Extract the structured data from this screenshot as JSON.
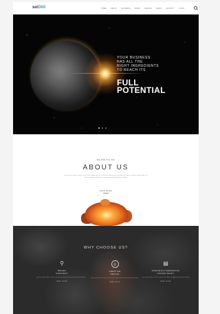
{
  "header": {
    "logo_main": "sol",
    "logo_accent": "360",
    "nav": [
      "HOME",
      "ABOUT",
      "BUSINESS",
      "WORK",
      "PEOPLE",
      "NEWS",
      "CONTACT",
      "LOGIN"
    ]
  },
  "hero": {
    "intro": "YOUR BUSINESS\nHAS ALL THE\nRIGHT INGREDIENTS\nTO REACH ITS",
    "headline": "FULL\nPOTENTIAL"
  },
  "about": {
    "kicker": "WE ARE SOL 360",
    "title": "ABOUT US",
    "body": "Lorem ipsum dolor sit amet, consectetur adipiscing elit, sed do eiusmod tempor incididunt ut labore et dolore magna aliqua. Ut enim ad minim veniam, quis nostrud exercitation ullamco laboris.",
    "link": "READ MORE"
  },
  "why": {
    "title": "WHY CHOOSE US?",
    "features": [
      {
        "icon": "person-icon",
        "glyph": "⚲",
        "name": "BRAND\nSTRATEGY",
        "desc": "Lorem ipsum dolor sit amet consectetur adipiscing elit sed do eiusmod tempor.",
        "more": "READ MORE"
      },
      {
        "icon": "target-icon",
        "glyph": "◎",
        "name": "CREATIVE\nDESIGN",
        "desc": "Lorem ipsum dolor sit amet consectetur adipiscing elit sed do eiusmod tempor.",
        "more": "READ MORE"
      },
      {
        "icon": "document-icon",
        "glyph": "▤",
        "name": "STRATEGIC MARKETING\nCONSULTANCY",
        "desc": "Lorem ipsum dolor sit amet consectetur adipiscing elit sed do eiusmod tempor.",
        "more": "READ MORE"
      }
    ],
    "prev": "‹",
    "next": "›"
  }
}
